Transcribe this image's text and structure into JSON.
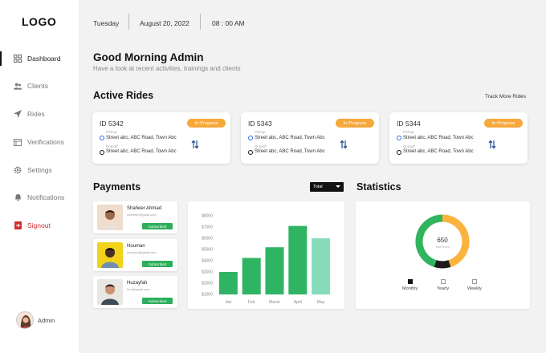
{
  "sidebar": {
    "logo": "LOGO",
    "items": [
      {
        "label": "Dashboard",
        "icon": "grid-icon"
      },
      {
        "label": "Clients",
        "icon": "users-icon"
      },
      {
        "label": "Rides",
        "icon": "send-icon"
      },
      {
        "label": "Verifications",
        "icon": "card-icon"
      },
      {
        "label": "Settings",
        "icon": "gear-icon"
      },
      {
        "label": "Notifications",
        "icon": "bell-icon"
      },
      {
        "label": "Signout",
        "icon": "signout-icon"
      }
    ],
    "user": {
      "name": "Admin"
    }
  },
  "topbar": {
    "day": "Tuesday",
    "date": "August 20, 2022",
    "time": "08 : 00 AM"
  },
  "greeting": {
    "title": "Good Morning Admin",
    "subtitle": "Have a look at recent activities, trainings and clients"
  },
  "active_rides": {
    "title": "Active Rides",
    "link": "Track More Rides",
    "rides": [
      {
        "id": "ID 5342",
        "status": "In-Progress",
        "pickup_label": "Pickup",
        "pickup": "Street abc, ABC Road, Town Abc",
        "dropoff_label": "Dropoff",
        "dropoff": "Street abc, ABC Road, Town Abc"
      },
      {
        "id": "ID 5343",
        "status": "In-Progress",
        "pickup_label": "Pickup",
        "pickup": "Street abc, ABC Road, Town Abc",
        "dropoff_label": "Dropoff",
        "dropoff": "Street abc, ABC Road, Town Abc"
      },
      {
        "id": "ID 5344",
        "status": "In-Progress",
        "pickup_label": "Pickup",
        "pickup": "Street abc, ABC Road, Town Abc",
        "dropoff_label": "Dropoff",
        "dropoff": "Street abc, ABC Road, Town Abc"
      }
    ]
  },
  "payments": {
    "title": "Payments",
    "filter": "Total",
    "people": [
      {
        "name": "Shaheer Ahmad",
        "email": "shaheer@gmail.com",
        "status": "Subscribed"
      },
      {
        "name": "Nouman",
        "email": "nouman@gmail.com",
        "status": "Subscribed"
      },
      {
        "name": "Huzayfah",
        "email": "huz@gmail.com",
        "status": "Subscribed"
      }
    ]
  },
  "chart_data": {
    "type": "bar",
    "categories": [
      "Jan",
      "Feb",
      "March",
      "April",
      "May"
    ],
    "values": [
      3000,
      4250,
      5200,
      7100,
      6000
    ],
    "colors": [
      "#2fb463",
      "#2fb463",
      "#2fb463",
      "#2fb463",
      "#86dcba"
    ],
    "ylim": [
      1000,
      8000
    ],
    "yticks": [
      "$8000",
      "$7000",
      "$6000",
      "$5000",
      "$4000",
      "$3000",
      "$2000",
      "$1000"
    ],
    "title": "",
    "xlabel": "",
    "ylabel": ""
  },
  "statistics": {
    "title": "Statistics",
    "total_value": "650",
    "total_label": "Total Rides",
    "ring": {
      "yellow_fraction": 0.45,
      "black_fraction": 0.1,
      "green_fraction": 0.45
    },
    "legend": [
      {
        "label": "Monthly",
        "color": "#111111",
        "selected": true
      },
      {
        "label": "Yearly",
        "color": "#ffffff",
        "selected": false
      },
      {
        "label": "Weekly",
        "color": "#ffffff",
        "selected": false
      }
    ]
  },
  "colors": {
    "accent_green": "#2dae5b",
    "status_orange": "#f7a83a",
    "signout_red": "#d32f2f"
  }
}
